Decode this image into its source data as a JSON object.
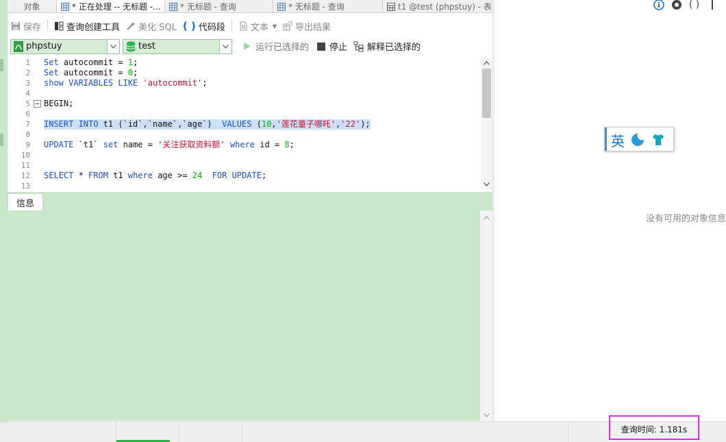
{
  "tabs": [
    {
      "label": "对象",
      "icon": "none",
      "active": false
    },
    {
      "label": "* 正在处理 -- 无标题 -...",
      "icon": "query-icon",
      "active": true
    },
    {
      "label": "* 无标题 - 查询",
      "icon": "query-icon",
      "active": false
    },
    {
      "label": "* 无标题 - 查询",
      "icon": "query-icon",
      "active": false
    },
    {
      "label": "t1 @test (phpstuy) - 表",
      "icon": "table-icon",
      "active": false
    }
  ],
  "toolbar": {
    "save": "保存",
    "query_builder": "查询创建工具",
    "beautify_sql": "美化 SQL",
    "code_snippet": "代码段",
    "text": "文本",
    "export": "导出结果"
  },
  "selectors": {
    "connection": "phpstuy",
    "database": "test",
    "run_selected": "运行已选择的",
    "stop": "停止",
    "explain_selected": "解释已选择的"
  },
  "editor": {
    "lines": [
      {
        "n": "1",
        "tokens": [
          {
            "t": "Set",
            "c": "kw"
          },
          {
            "t": " autocommit = ",
            "c": "plain"
          },
          {
            "t": "1",
            "c": "num"
          },
          {
            "t": ";",
            "c": "plain"
          }
        ]
      },
      {
        "n": "2",
        "tokens": [
          {
            "t": "Set",
            "c": "kw"
          },
          {
            "t": " autocommit = ",
            "c": "plain"
          },
          {
            "t": "0",
            "c": "num"
          },
          {
            "t": ";",
            "c": "plain"
          }
        ]
      },
      {
        "n": "3",
        "tokens": [
          {
            "t": "show VARIABLES LIKE",
            "c": "kw"
          },
          {
            "t": " ",
            "c": "plain"
          },
          {
            "t": "'autocommit'",
            "c": "str"
          },
          {
            "t": ";",
            "c": "plain"
          }
        ]
      },
      {
        "n": "4",
        "tokens": []
      },
      {
        "n": "5",
        "fold": true,
        "tokens": [
          {
            "t": "BEGIN;",
            "c": "plain"
          }
        ]
      },
      {
        "n": "6",
        "tokens": []
      },
      {
        "n": "7",
        "selected": true,
        "tokens": [
          {
            "t": "INSERT INTO",
            "c": "kw"
          },
          {
            "t": " t1 (`id`,`name`,`age`)  ",
            "c": "plain"
          },
          {
            "t": "VALUES",
            "c": "kw"
          },
          {
            "t": " (",
            "c": "plain"
          },
          {
            "t": "10",
            "c": "num"
          },
          {
            "t": ",",
            "c": "plain"
          },
          {
            "t": "'莲花童子哪吒'",
            "c": "str"
          },
          {
            "t": ",",
            "c": "plain"
          },
          {
            "t": "'22'",
            "c": "str"
          },
          {
            "t": ");",
            "c": "plain"
          }
        ]
      },
      {
        "n": "8",
        "tokens": []
      },
      {
        "n": "9",
        "tokens": [
          {
            "t": "UPDATE",
            "c": "kw"
          },
          {
            "t": " `t1` ",
            "c": "plain"
          },
          {
            "t": "set",
            "c": "kw"
          },
          {
            "t": " name = ",
            "c": "plain"
          },
          {
            "t": "'关注获取资料额'",
            "c": "str"
          },
          {
            "t": " ",
            "c": "plain"
          },
          {
            "t": "where",
            "c": "kw"
          },
          {
            "t": " id = ",
            "c": "plain"
          },
          {
            "t": "8",
            "c": "num"
          },
          {
            "t": ";",
            "c": "plain"
          }
        ]
      },
      {
        "n": "10",
        "tokens": []
      },
      {
        "n": "11",
        "tokens": []
      },
      {
        "n": "12",
        "tokens": [
          {
            "t": "SELECT",
            "c": "kw"
          },
          {
            "t": " * ",
            "c": "plain"
          },
          {
            "t": "FROM",
            "c": "kw"
          },
          {
            "t": " t1 ",
            "c": "plain"
          },
          {
            "t": "where",
            "c": "kw"
          },
          {
            "t": " age >= ",
            "c": "plain"
          },
          {
            "t": "24",
            "c": "num"
          },
          {
            "t": "  ",
            "c": "plain"
          },
          {
            "t": "FOR UPDATE",
            "c": "kw"
          },
          {
            "t": ";",
            "c": "plain"
          }
        ]
      },
      {
        "n": "13",
        "tokens": []
      }
    ]
  },
  "info_panel": {
    "tab_label": "信息"
  },
  "right_panel": {
    "empty_text": "没有可用的对象信息",
    "ime_label": "英"
  },
  "status": {
    "query_time": "查询时间: 1.181s"
  },
  "colors": {
    "keyword": "#1a4fc9",
    "number": "#14a614",
    "string": "#c8102e",
    "highlight": "#e12be0",
    "panel_green": "#c9e7c9"
  }
}
